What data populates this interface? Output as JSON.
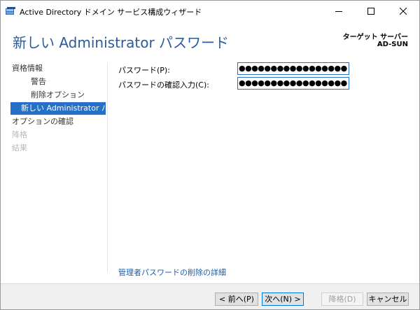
{
  "window": {
    "title": "Active Directory ドメイン サービス構成ウィザード",
    "controls": {
      "minimize": "minimize",
      "maximize": "maximize",
      "close": "close"
    }
  },
  "header": {
    "page_title": "新しい Administrator パスワード",
    "target_label": "ターゲット サーバー",
    "target_name": "AD-SUN"
  },
  "nav": {
    "items": [
      {
        "label": "資格情報",
        "state": "normal"
      },
      {
        "label": "警告",
        "state": "normal"
      },
      {
        "label": "削除オプション",
        "state": "normal"
      },
      {
        "label": "新しい Administrator パス...",
        "state": "active"
      },
      {
        "label": "オプションの確認",
        "state": "normal"
      },
      {
        "label": "降格",
        "state": "disabled"
      },
      {
        "label": "結果",
        "state": "disabled"
      }
    ]
  },
  "form": {
    "password_label": "パスワード(P):",
    "password_value": "●●●●●●●●●●●●●●●●●",
    "confirm_label": "パスワードの確認入力(C):",
    "confirm_value": "●●●●●●●●●●●●●●●●●"
  },
  "help_link": "管理者パスワードの削除の詳細",
  "buttons": {
    "prev": "< 前へ(P)",
    "next": "次へ(N) >",
    "install": "降格(D)",
    "cancel": "キャンセル"
  },
  "colors": {
    "accent": "#2670c8",
    "title_blue": "#2a5b9c",
    "link": "#1b5fae",
    "disabled_text": "#b9b9b9"
  }
}
